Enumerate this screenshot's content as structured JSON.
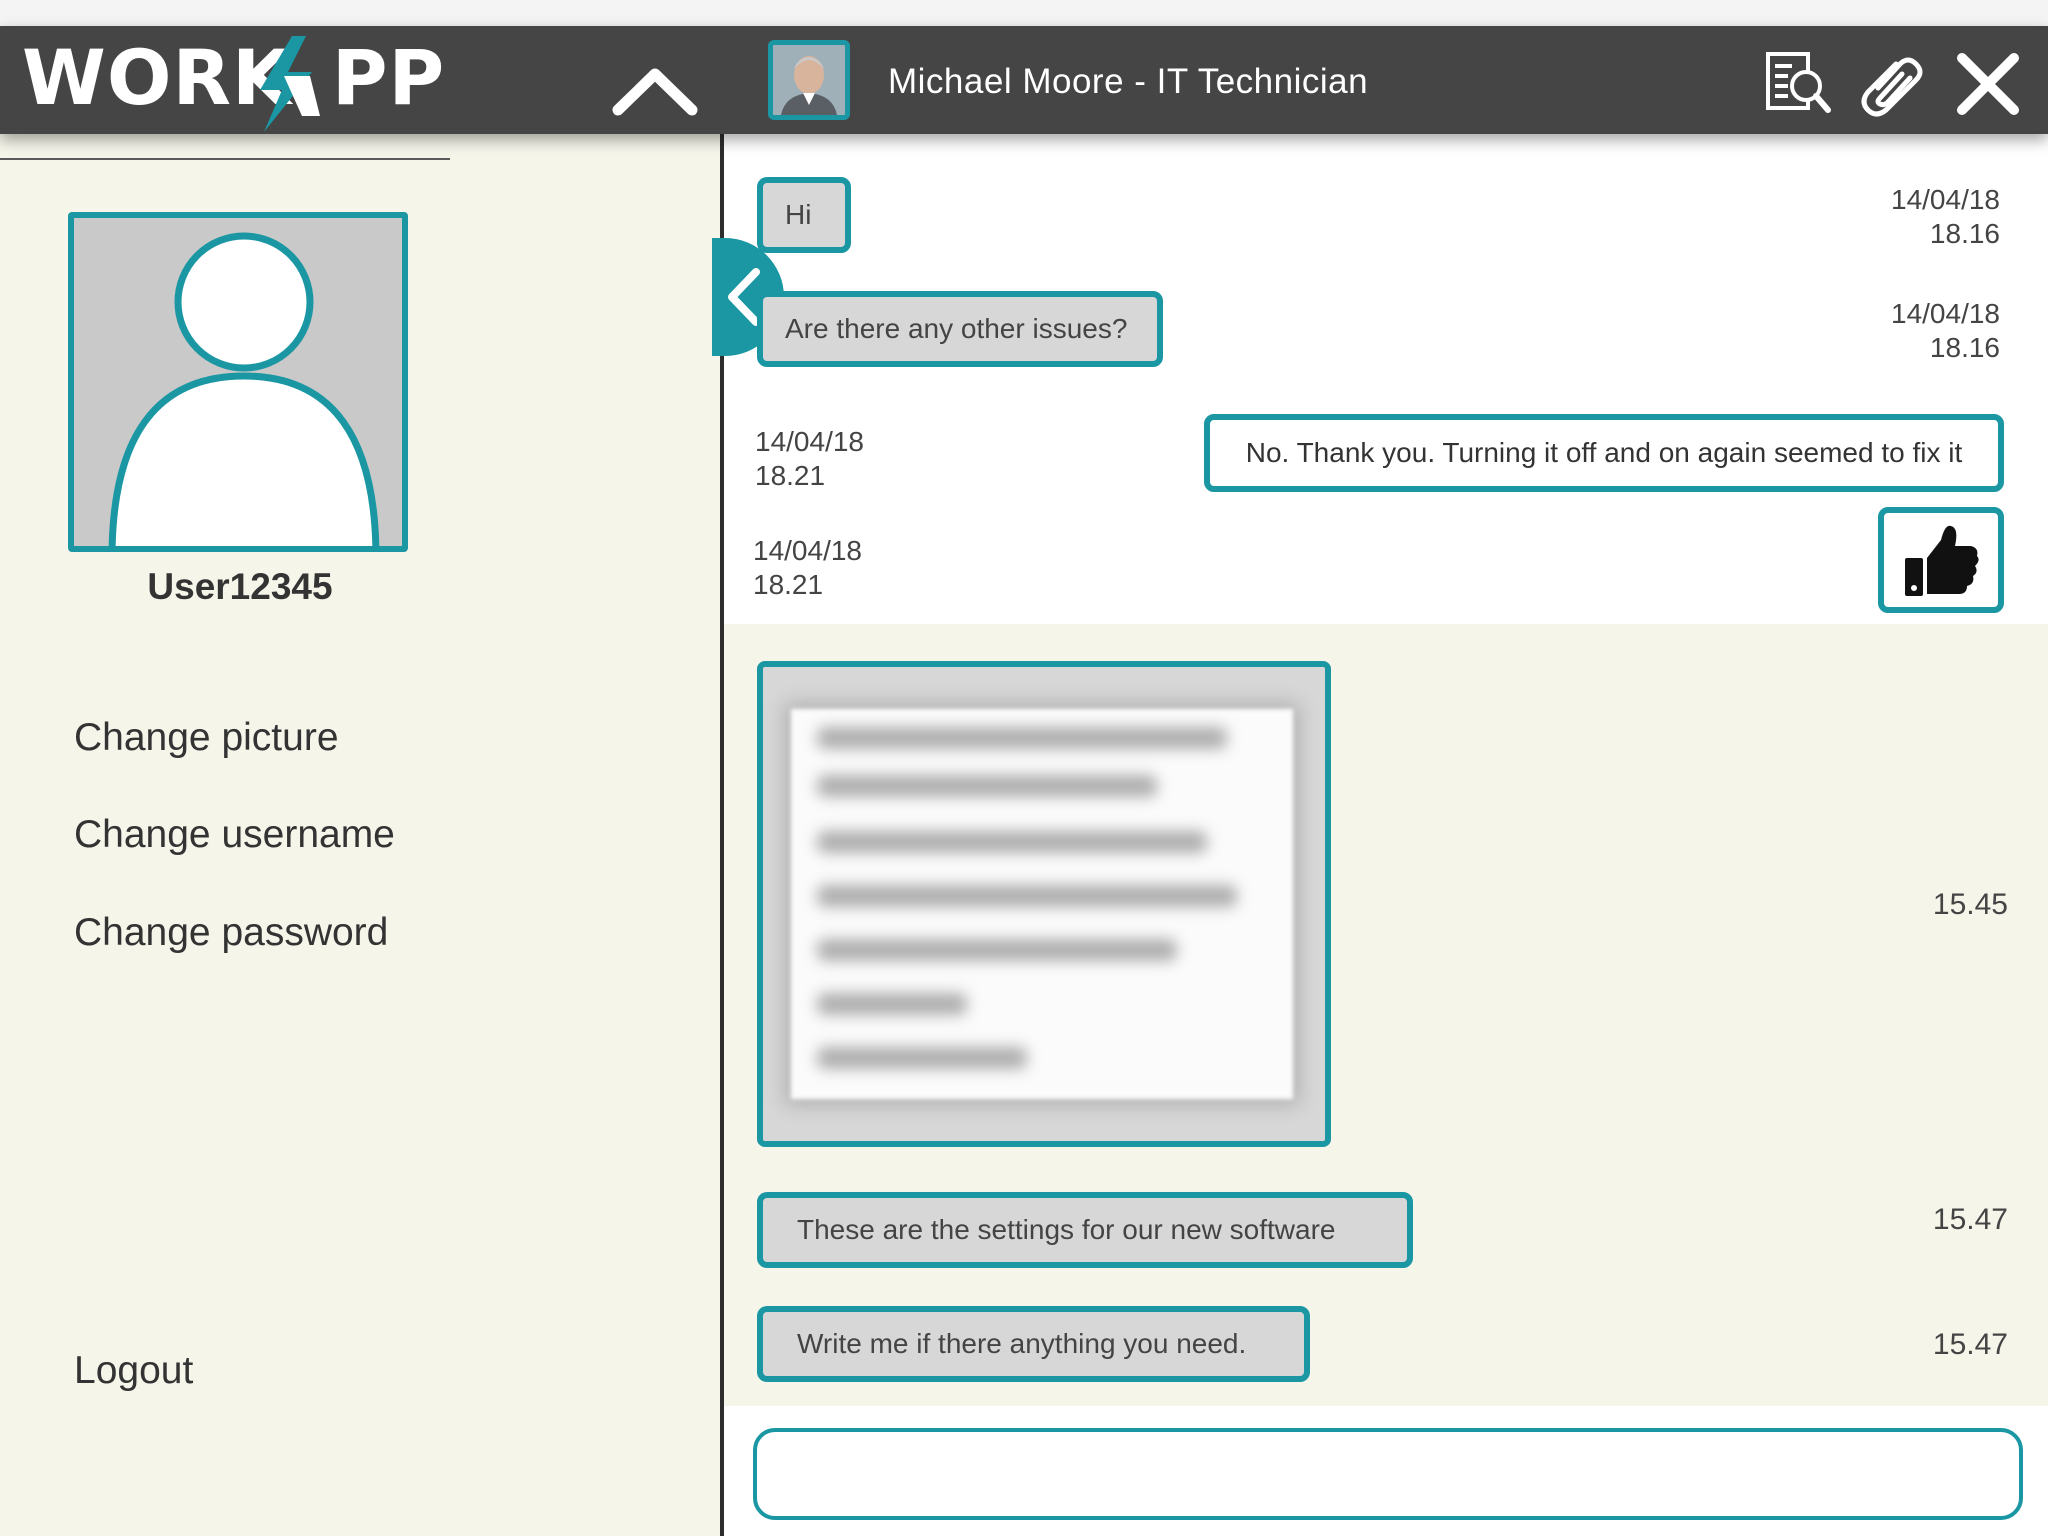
{
  "app": {
    "logo_left": "WORK",
    "logo_right": "PP",
    "accent": "#1a97a3",
    "header_bg": "#454545"
  },
  "header": {
    "contact_name": "Michael Moore - IT Technician",
    "icons": [
      "collapse-up-icon",
      "search-document-icon",
      "paperclip-icon",
      "close-icon"
    ]
  },
  "sidebar": {
    "username": "User12345",
    "menu": [
      "Change picture",
      "Change username",
      "Change password"
    ],
    "logout": "Logout"
  },
  "chat": {
    "messages": [
      {
        "text": "Hi",
        "date": "14/04/18",
        "time": "18.16",
        "direction": "in"
      },
      {
        "text": "Are there any other issues?",
        "date": "14/04/18",
        "time": "18.16",
        "direction": "in"
      },
      {
        "text": "No. Thank you. Turning it off and on again seemed to fix it",
        "date": "14/04/18",
        "time": "18.21",
        "direction": "out"
      },
      {
        "icon": "thumbs-up-icon",
        "date": "14/04/18",
        "time": "18.21",
        "direction": "out"
      },
      {
        "attachment": "blurred-image",
        "time": "15.45",
        "direction": "in"
      },
      {
        "text": "These are the settings for our new software",
        "time": "15.47",
        "direction": "in"
      },
      {
        "text": "Write me if there anything you need.",
        "time": "15.47",
        "direction": "in"
      }
    ],
    "input": {
      "value": "",
      "placeholder": ""
    }
  }
}
